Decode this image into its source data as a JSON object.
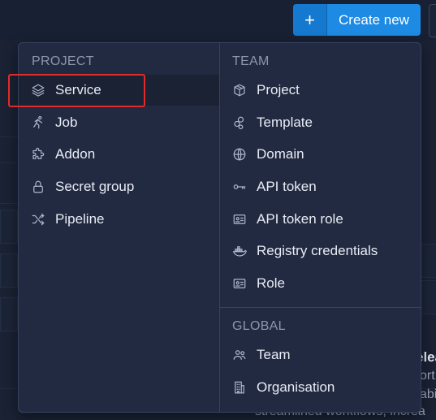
{
  "topbar": {
    "create_plus": "+",
    "create_label": "Create new"
  },
  "menu": {
    "project_section": "PROJECT",
    "project_items": [
      {
        "label": "Service",
        "icon": "layers-icon"
      },
      {
        "label": "Job",
        "icon": "runner-icon"
      },
      {
        "label": "Addon",
        "icon": "puzzle-icon"
      },
      {
        "label": "Secret group",
        "icon": "lock-icon"
      },
      {
        "label": "Pipeline",
        "icon": "shuffle-icon"
      }
    ],
    "team_section": "TEAM",
    "team_items": [
      {
        "label": "Project",
        "icon": "box-icon"
      },
      {
        "label": "Template",
        "icon": "shapes-icon"
      },
      {
        "label": "Domain",
        "icon": "globe-icon"
      },
      {
        "label": "API token",
        "icon": "key-icon"
      },
      {
        "label": "API token role",
        "icon": "id-card-icon"
      },
      {
        "label": "Registry credentials",
        "icon": "docker-icon"
      },
      {
        "label": "Role",
        "icon": "id-card-icon"
      }
    ],
    "global_section": "GLOBAL",
    "global_items": [
      {
        "label": "Team",
        "icon": "users-icon"
      },
      {
        "label": "Organisation",
        "icon": "building-icon"
      }
    ]
  },
  "background": {
    "text_fragment_1": "elea",
    "text_fragment_2": "ort",
    "text_fragment_3": "abi",
    "text_fragment_4": "streamlined workflows, increa"
  },
  "colors": {
    "accent": "#1d8ae3",
    "highlight": "#e02b2b",
    "menu_bg": "#212a41"
  }
}
